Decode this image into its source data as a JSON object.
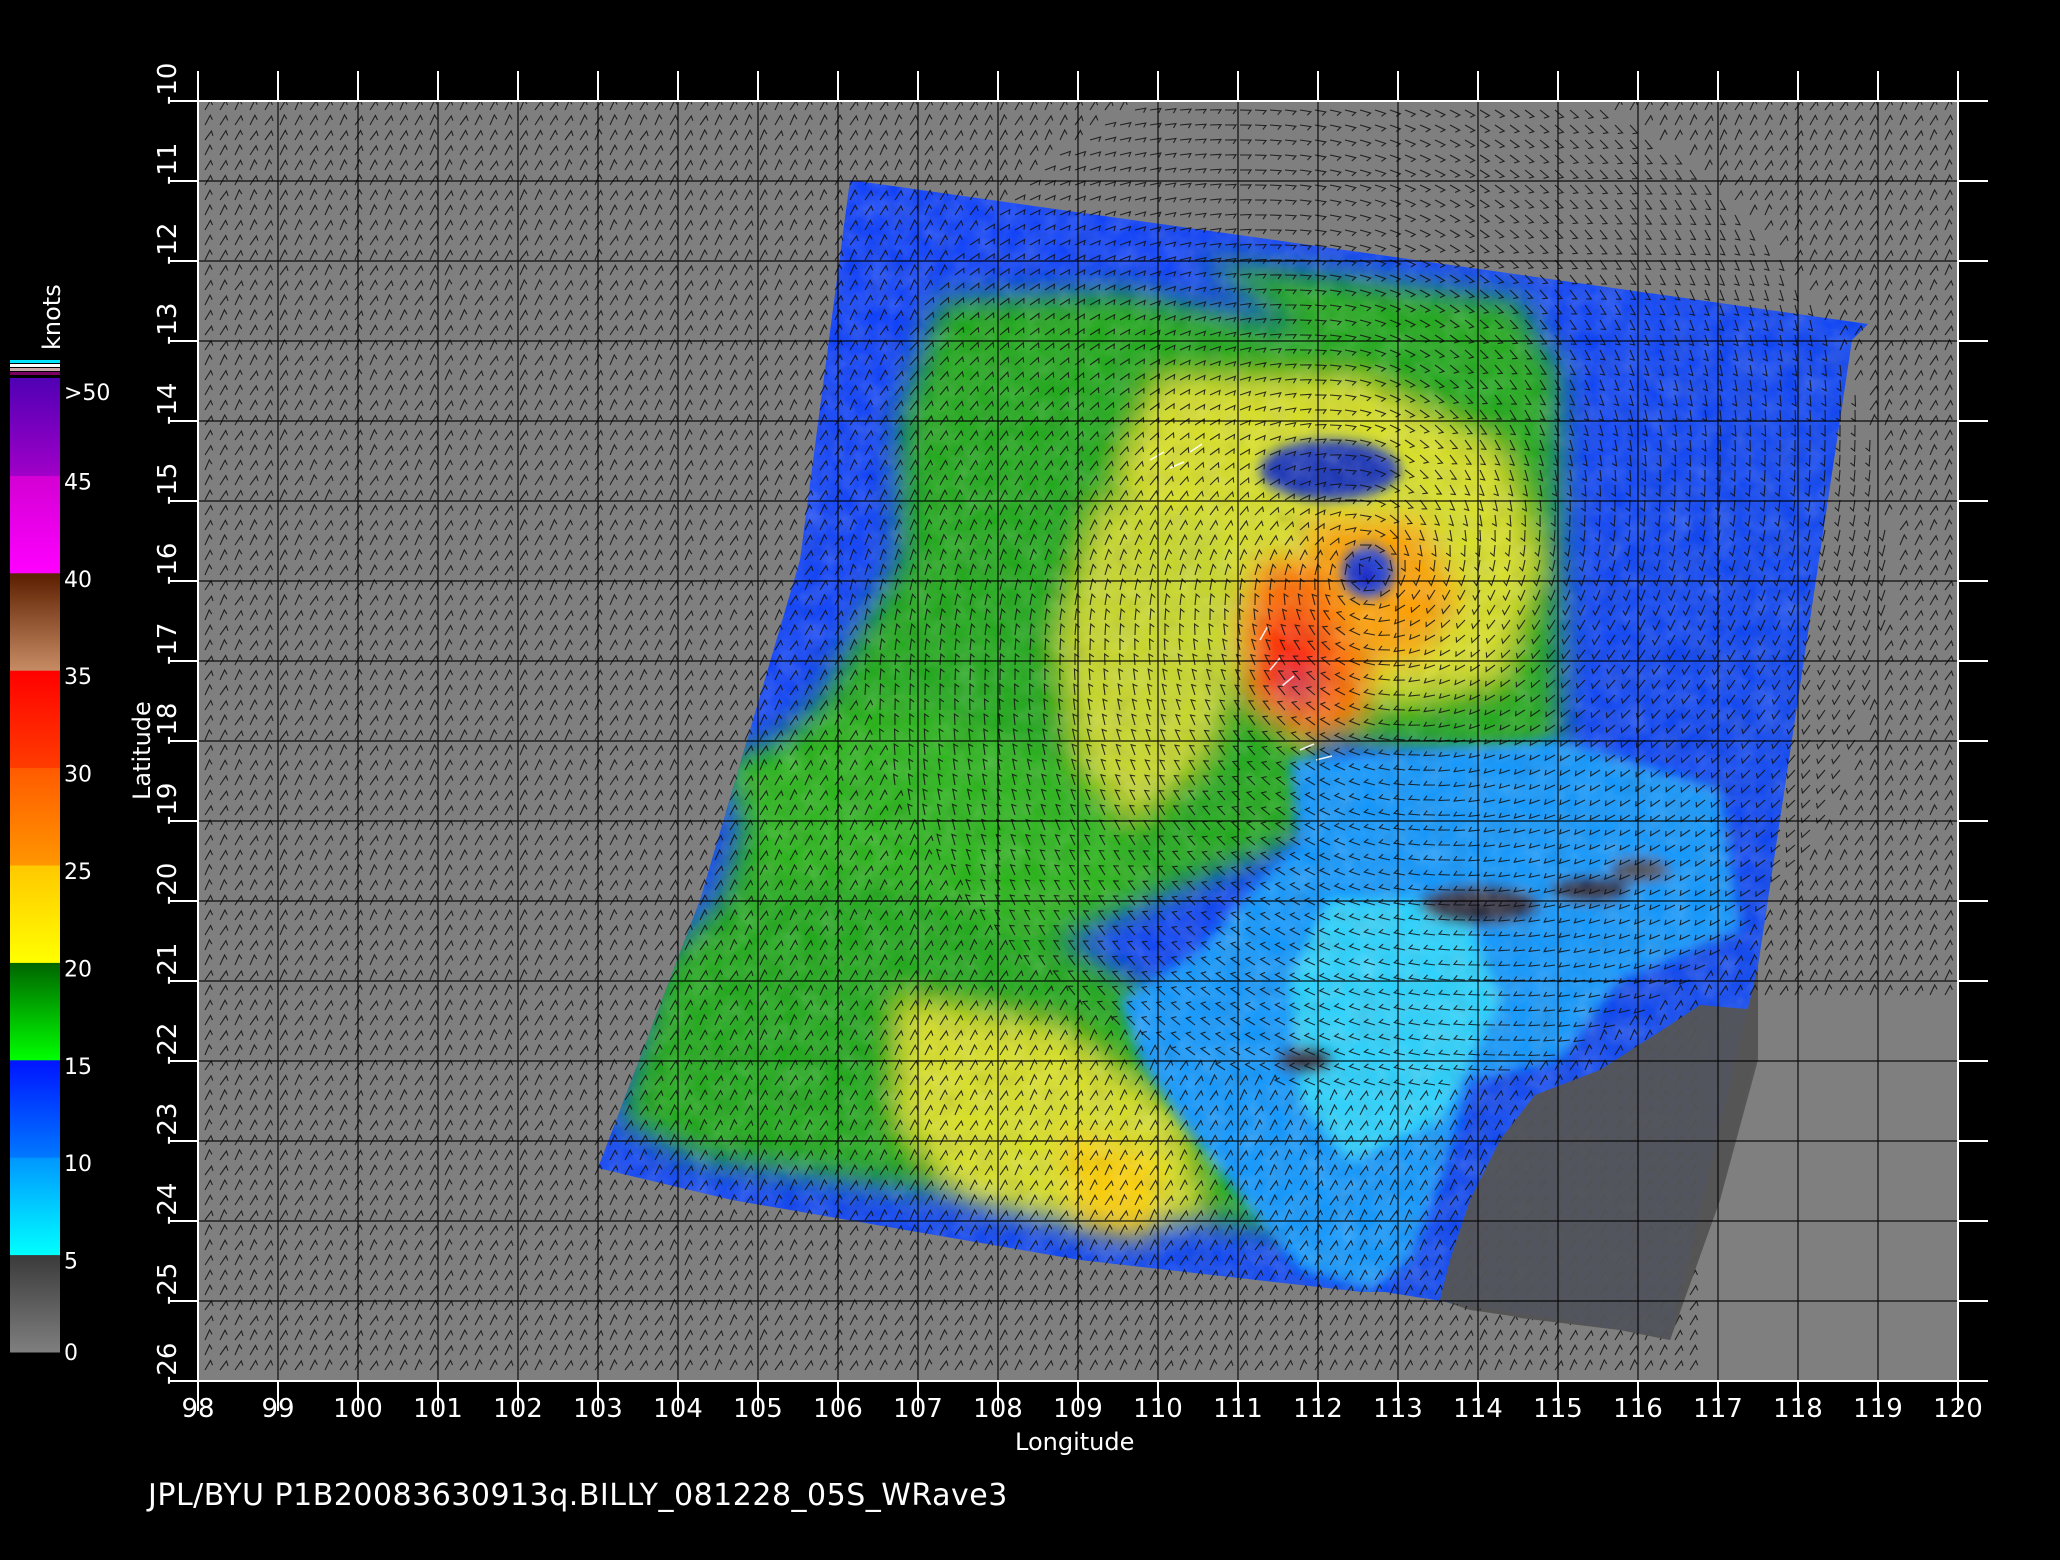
{
  "map": {
    "x_axis_label": "Longitude",
    "y_axis_label": "Latitude",
    "lon_ticks": [
      "98",
      "99",
      "100",
      "101",
      "102",
      "103",
      "104",
      "105",
      "106",
      "107",
      "108",
      "109",
      "110",
      "111",
      "112",
      "113",
      "114",
      "115",
      "116",
      "117",
      "118",
      "119",
      "120"
    ],
    "lat_ticks": [
      "-10",
      "-11",
      "-12",
      "-13",
      "-14",
      "-15",
      "-16",
      "-17",
      "-18",
      "-19",
      "-20",
      "-21",
      "-22",
      "-23",
      "-24",
      "-25",
      "-26"
    ],
    "lon_range": [
      98,
      120
    ],
    "lat_range": [
      -26,
      -10
    ],
    "land_color": "#555555",
    "no_data_color": "#7f7f7f",
    "grid_color": "#000000"
  },
  "colorbar": {
    "unit_label": "knots",
    "tick_labels": [
      ">50",
      "45",
      "40",
      "35",
      "30",
      "25",
      "20",
      "15",
      "10",
      "5",
      "0"
    ],
    "segments": [
      {
        "from": 0,
        "to": 5,
        "colors": [
          "#7f7f7f",
          "#3a3a3a"
        ]
      },
      {
        "from": 5,
        "to": 10,
        "colors": [
          "#00ffff",
          "#0096ff"
        ]
      },
      {
        "from": 10,
        "to": 15,
        "colors": [
          "#0078ff",
          "#0014ff"
        ]
      },
      {
        "from": 15,
        "to": 20,
        "colors": [
          "#00ff00",
          "#006400"
        ]
      },
      {
        "from": 20,
        "to": 25,
        "colors": [
          "#ffff00",
          "#ffc800"
        ]
      },
      {
        "from": 25,
        "to": 30,
        "colors": [
          "#ff9600",
          "#ff5a00"
        ]
      },
      {
        "from": 30,
        "to": 35,
        "colors": [
          "#ff3c00",
          "#ff0000"
        ]
      },
      {
        "from": 35,
        "to": 40,
        "colors": [
          "#c88c64",
          "#5a1e00"
        ]
      },
      {
        "from": 40,
        "to": 45,
        "colors": [
          "#ff00ff",
          "#d200d2"
        ]
      },
      {
        "from": 45,
        "to": 50,
        "colors": [
          "#a000c8",
          "#5000b4"
        ]
      }
    ]
  },
  "footer": {
    "caption": "JPL/BYU  P1B20083630913q.BILLY_081228_05S_WRave3"
  }
}
